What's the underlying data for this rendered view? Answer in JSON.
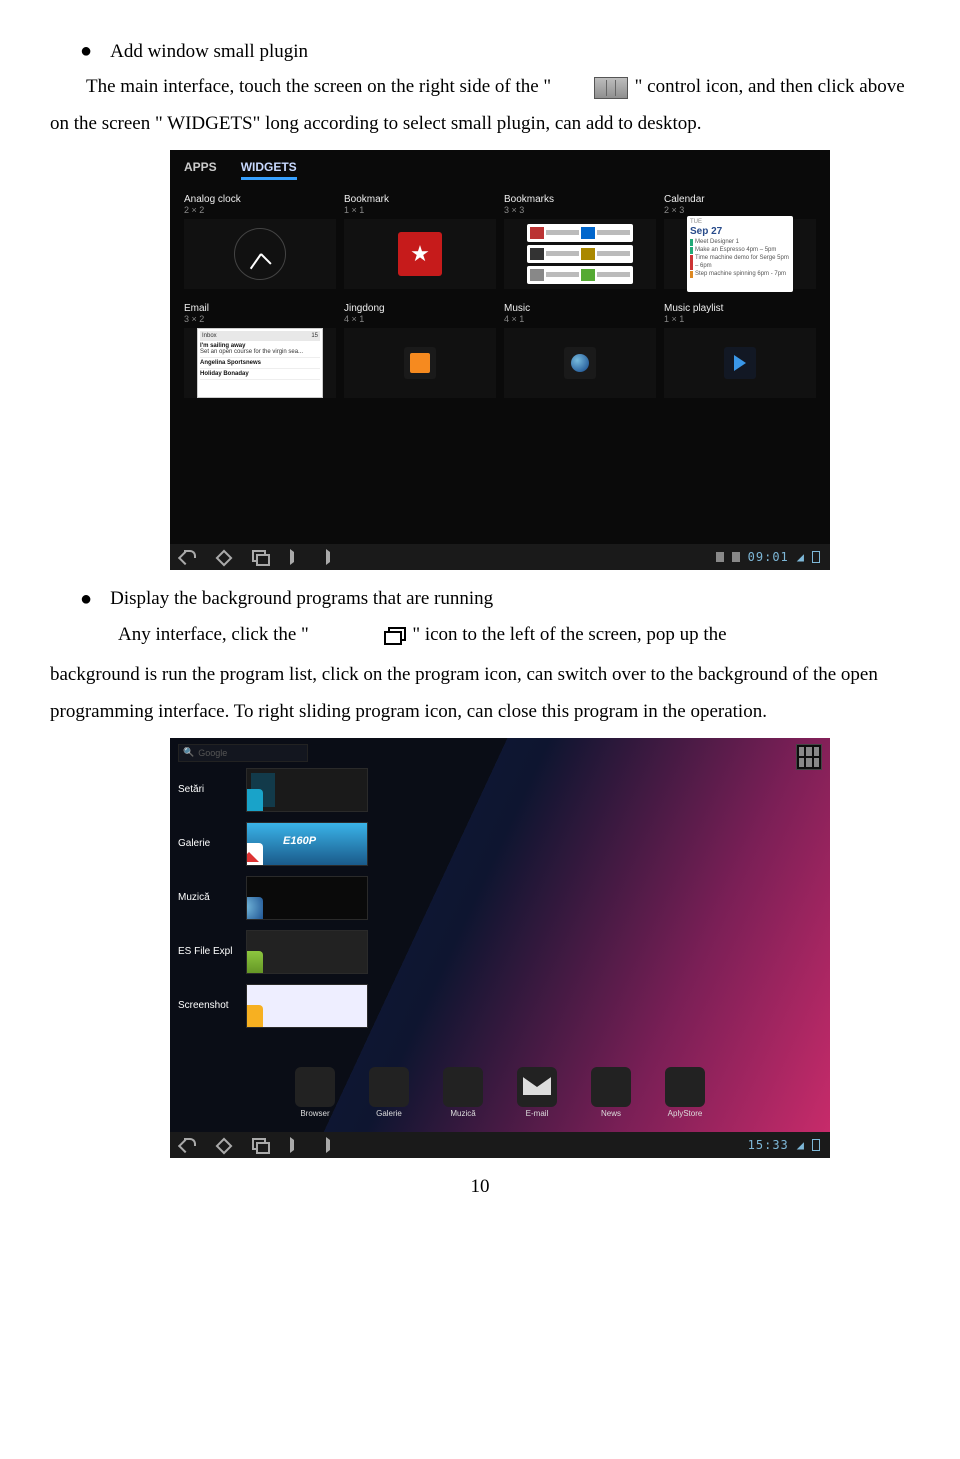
{
  "section1": {
    "title": "Add window small plugin",
    "para1a": "The main interface, touch the screen on the right side of the \"",
    "para1b": "\" control icon, and then click above on the screen \" WIDGETS\" long according to select small plugin, can add to desktop."
  },
  "section2": {
    "title": "Display the background programs that are running",
    "line1a": "Any interface, click the \"",
    "line1b": "\" icon to the left of the screen, pop up the",
    "para2": "background is run the program list, click on the program icon, can switch over to the background of the open programming interface. To right sliding program icon, can close this program in the operation."
  },
  "shot1": {
    "tabs": {
      "apps": "APPS",
      "widgets": "WIDGETS"
    },
    "widgets": [
      {
        "name": "Analog clock",
        "dim": "2 × 2"
      },
      {
        "name": "Bookmark",
        "dim": "1 × 1"
      },
      {
        "name": "Bookmarks",
        "dim": "3 × 3"
      },
      {
        "name": "Calendar",
        "dim": "2 × 3"
      },
      {
        "name": "Email",
        "dim": "3 × 2"
      },
      {
        "name": "Jingdong",
        "dim": "4 × 1"
      },
      {
        "name": "Music",
        "dim": "4 × 1"
      },
      {
        "name": "Music playlist",
        "dim": "1 × 1"
      }
    ],
    "cal": {
      "date": "Sep 27",
      "e1": "Meet Designer 1",
      "e2": "Make an Espresso 4pm – 5pm",
      "e3": "Time machine demo for Serge 5pm – 6pm",
      "e4": "Step machine spinning 6pm - 7pm"
    },
    "email": {
      "inbox": "Inbox",
      "count": "15",
      "r1t": "I'm sailing away",
      "r1b": "Set an open course for the virgin sea...",
      "r2t": "Angelina Sportsnews",
      "r3t": "Holiday Bonaday"
    },
    "clock": "09:01"
  },
  "shot2": {
    "search": "Google",
    "recents": [
      {
        "label": "Setări"
      },
      {
        "label": "Galerie",
        "brand": "E160P"
      },
      {
        "label": "Muzică"
      },
      {
        "label": "ES File Expl"
      },
      {
        "label": "Screenshot"
      }
    ],
    "dock": [
      {
        "label": "Browser"
      },
      {
        "label": "Galerie"
      },
      {
        "label": "Muzică"
      },
      {
        "label": "E-mail"
      },
      {
        "label": "News"
      },
      {
        "label": "AplyStore"
      }
    ],
    "clock": "15:33"
  },
  "pageNumber": "10"
}
